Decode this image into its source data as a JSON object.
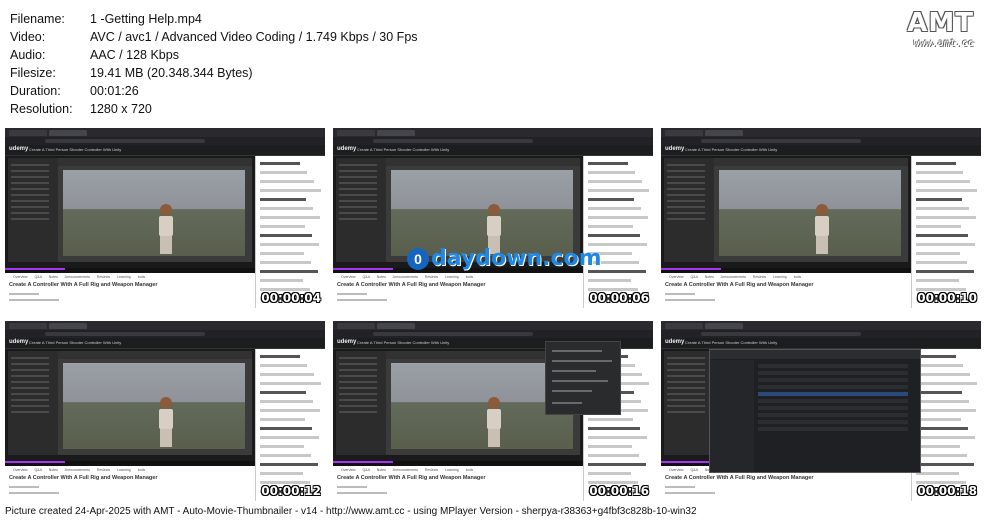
{
  "info": {
    "rows": [
      {
        "key": "Filename:",
        "value": "1 -Getting Help.mp4"
      },
      {
        "key": "Video:",
        "value": "AVC / avc1 / Advanced Video Coding / 1.749 Kbps / 30 Fps"
      },
      {
        "key": "Audio:",
        "value": "AAC / 128 Kbps"
      },
      {
        "key": "Filesize:",
        "value": "19.41 MB (20.348.344 Bytes)"
      },
      {
        "key": "Duration:",
        "value": "00:01:26"
      },
      {
        "key": "Resolution:",
        "value": "1280 x 720"
      }
    ]
  },
  "logo": {
    "text": "AMT",
    "url": "www.amt.cc"
  },
  "thumb_common": {
    "udemy": "udemy",
    "header_title": "Create A Third Person Shooter Controller With Unity",
    "below_tabs": "Overview  Q&A  Notes  Announcements  Reviews  Learning tools",
    "course_title": "Create A Controller With A Full Rig and Weapon Manager"
  },
  "thumbnails": [
    {
      "timestamp": "00:00:04"
    },
    {
      "timestamp": "00:00:06"
    },
    {
      "timestamp": "00:00:10"
    },
    {
      "timestamp": "00:00:12"
    },
    {
      "timestamp": "00:00:16"
    },
    {
      "timestamp": "00:00:18"
    }
  ],
  "watermark": {
    "circle": "0",
    "text": "daydown.com"
  },
  "footer": {
    "text": "Picture created 24-Apr-2025 with AMT - Auto-Movie-Thumbnailer - v14 - http://www.amt.cc - using MPlayer Version - sherpya-r38363+g4fbf3c828b-10-win32"
  }
}
